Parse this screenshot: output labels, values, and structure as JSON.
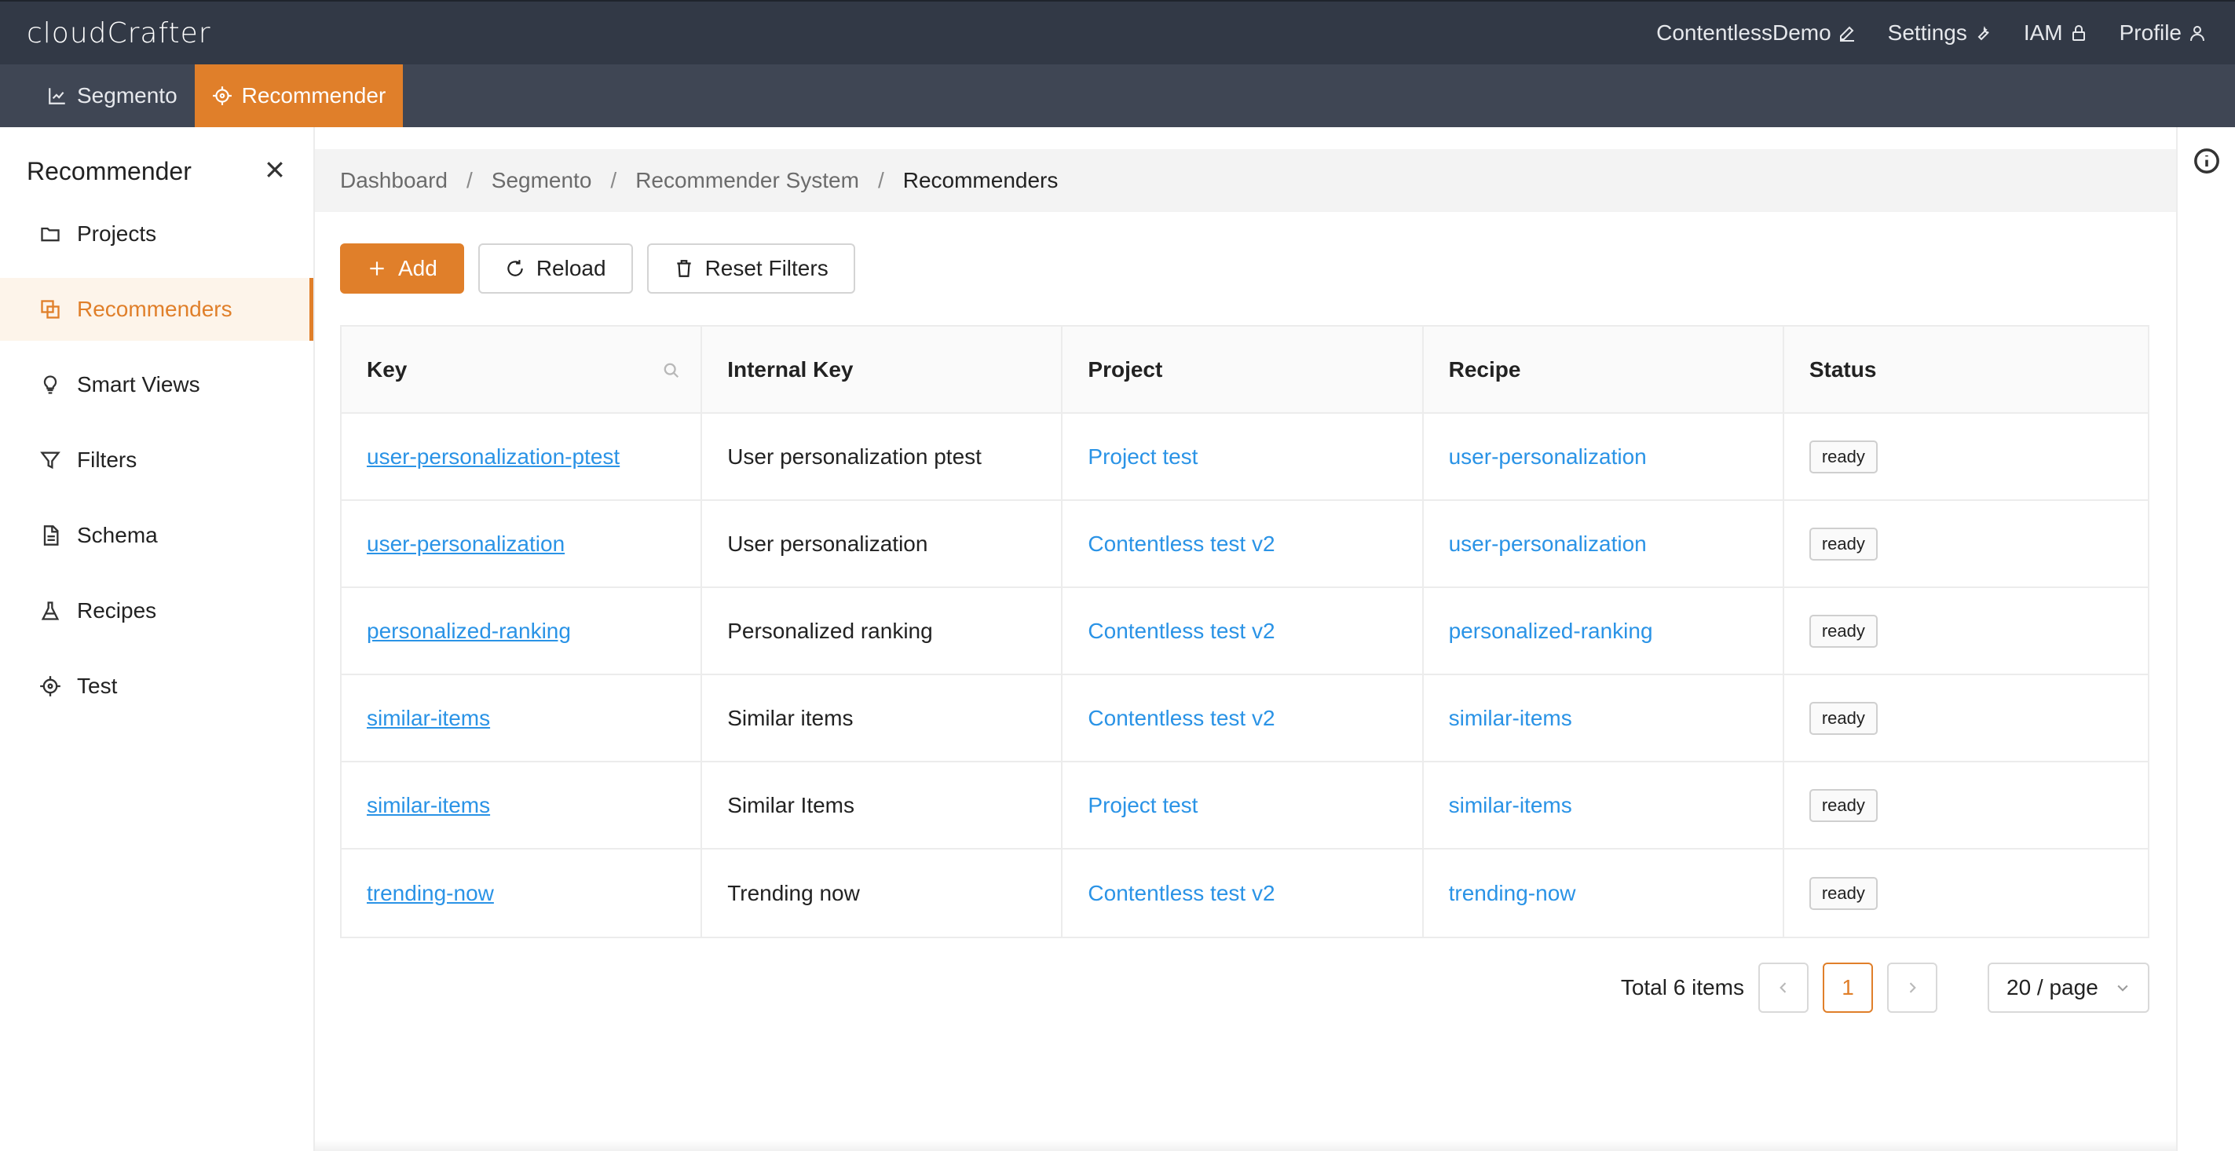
{
  "app": {
    "logo": "cloudCrafter"
  },
  "topnav": {
    "items": [
      {
        "label": "ContentlessDemo",
        "icon": "pencil-icon"
      },
      {
        "label": "Settings",
        "icon": "wrench-icon"
      },
      {
        "label": "IAM",
        "icon": "lock-icon"
      },
      {
        "label": "Profile",
        "icon": "user-icon"
      }
    ]
  },
  "modules": [
    {
      "label": "Segmento",
      "icon": "chart-icon",
      "active": false
    },
    {
      "label": "Recommender",
      "icon": "target-icon",
      "active": true
    }
  ],
  "sidebar": {
    "title": "Recommender",
    "items": [
      {
        "label": "Projects",
        "icon": "folder-icon"
      },
      {
        "label": "Recommenders",
        "icon": "copy-icon",
        "active": true
      },
      {
        "label": "Smart Views",
        "icon": "bulb-icon"
      },
      {
        "label": "Filters",
        "icon": "filter-icon"
      },
      {
        "label": "Schema",
        "icon": "document-icon"
      },
      {
        "label": "Recipes",
        "icon": "flask-icon"
      },
      {
        "label": "Test",
        "icon": "target-icon"
      }
    ]
  },
  "breadcrumb": [
    "Dashboard",
    "Segmento",
    "Recommender System",
    "Recommenders"
  ],
  "toolbar": {
    "add": "Add",
    "reload": "Reload",
    "reset": "Reset Filters"
  },
  "table": {
    "columns": [
      "Key",
      "Internal Key",
      "Project",
      "Recipe",
      "Status"
    ],
    "rows": [
      {
        "key": "user-personalization-ptest",
        "internal": "User personalization ptest",
        "project": "Project test",
        "recipe": "user-personalization",
        "status": "ready"
      },
      {
        "key": "user-personalization",
        "internal": "User personalization",
        "project": "Contentless test v2",
        "recipe": "user-personalization",
        "status": "ready"
      },
      {
        "key": "personalized-ranking",
        "internal": "Personalized ranking",
        "project": "Contentless test v2",
        "recipe": "personalized-ranking",
        "status": "ready"
      },
      {
        "key": "similar-items",
        "internal": "Similar items",
        "project": "Contentless test v2",
        "recipe": "similar-items",
        "status": "ready"
      },
      {
        "key": "similar-items",
        "internal": "Similar Items",
        "project": "Project test",
        "recipe": "similar-items",
        "status": "ready"
      },
      {
        "key": "trending-now",
        "internal": "Trending now",
        "project": "Contentless test v2",
        "recipe": "trending-now",
        "status": "ready"
      }
    ]
  },
  "pagination": {
    "total": "Total 6 items",
    "current_page": "1",
    "page_size": "20 / page"
  },
  "colors": {
    "accent": "#e07f2a",
    "link": "#2a93e6",
    "topbar": "#323946",
    "modbar": "#3f4654"
  }
}
